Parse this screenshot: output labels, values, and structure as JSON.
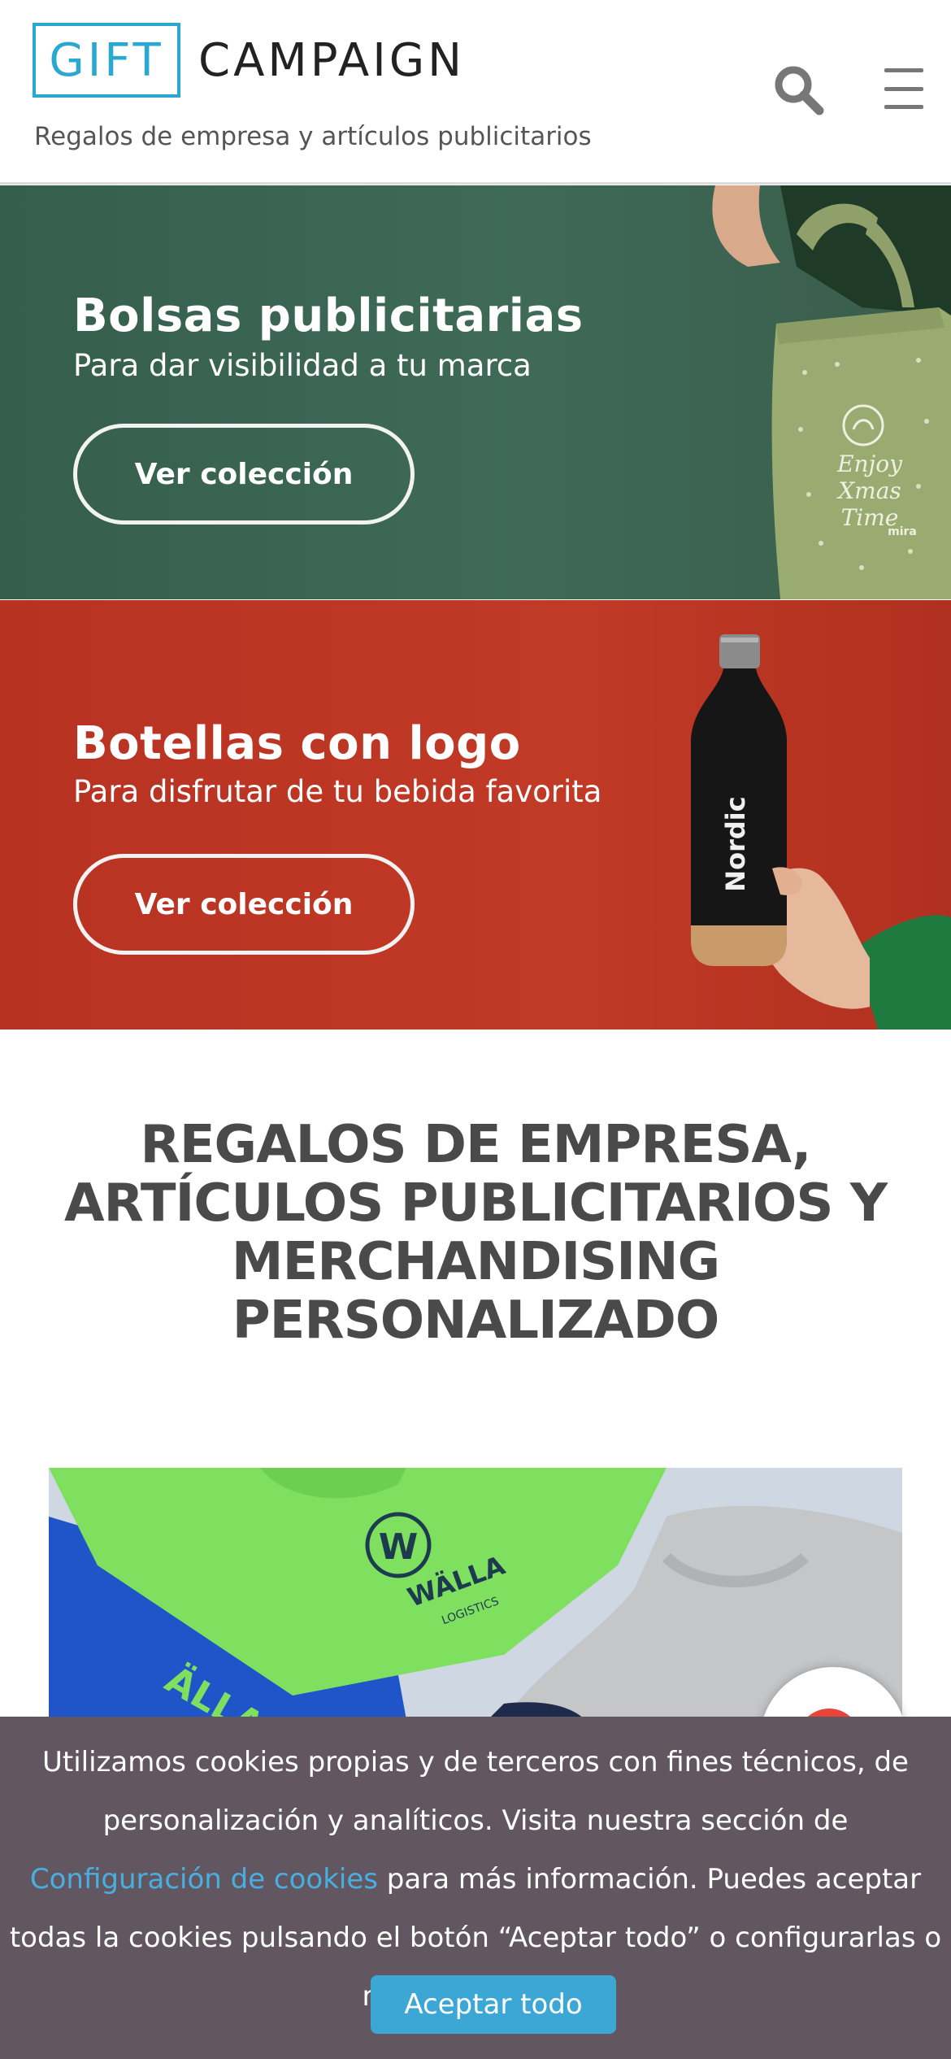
{
  "header": {
    "logo_left": "GIFT",
    "logo_right": "CAMPAIGN",
    "tagline": "Regalos de empresa y artículos publicitarios",
    "search_icon": "search-icon",
    "menu_icon": "hamburger-menu-icon"
  },
  "banners": [
    {
      "title": "Bolsas publicitarias",
      "subtitle": "Para dar visibilidad a tu marca",
      "button": "Ver colección",
      "bag_print": [
        "Enjoy",
        "Xmas",
        "Time"
      ],
      "bag_brand": "mira",
      "background": "#3f6a58"
    },
    {
      "title": "Botellas con logo",
      "subtitle": "Para disfrutar de tu bebida favorita",
      "button": "Ver colección",
      "bottle_print": "Nordic",
      "background": "#c13a26"
    }
  ],
  "main": {
    "heading": "REGALOS DE EMPRESA, ARTÍCULOS PUBLICITARIOS Y MERCHANDISING PERSONALIZADO",
    "shirt_logo_letter": "W",
    "shirt_brand": "WÄLLA",
    "shirt_sub": "LOGISTICS",
    "shirt_partial": "ÄLLA"
  },
  "cookies": {
    "text_before": "Utilizamos cookies propias y de terceros con fines técnicos, de personalización y analíticos. Visita nuestra sección de ",
    "link": "Configuración de cookies",
    "text_after": " para más información. Puedes aceptar todas la cookies pulsando el botón “Aceptar todo” o configurarlas o rechazar su uso.",
    "accept_button": "Aceptar todo"
  },
  "colors": {
    "brand_blue": "#2aa8cf",
    "cookie_bg": "#625660",
    "cookie_button": "#3ca6d4",
    "cookie_link": "#48b0e0"
  }
}
